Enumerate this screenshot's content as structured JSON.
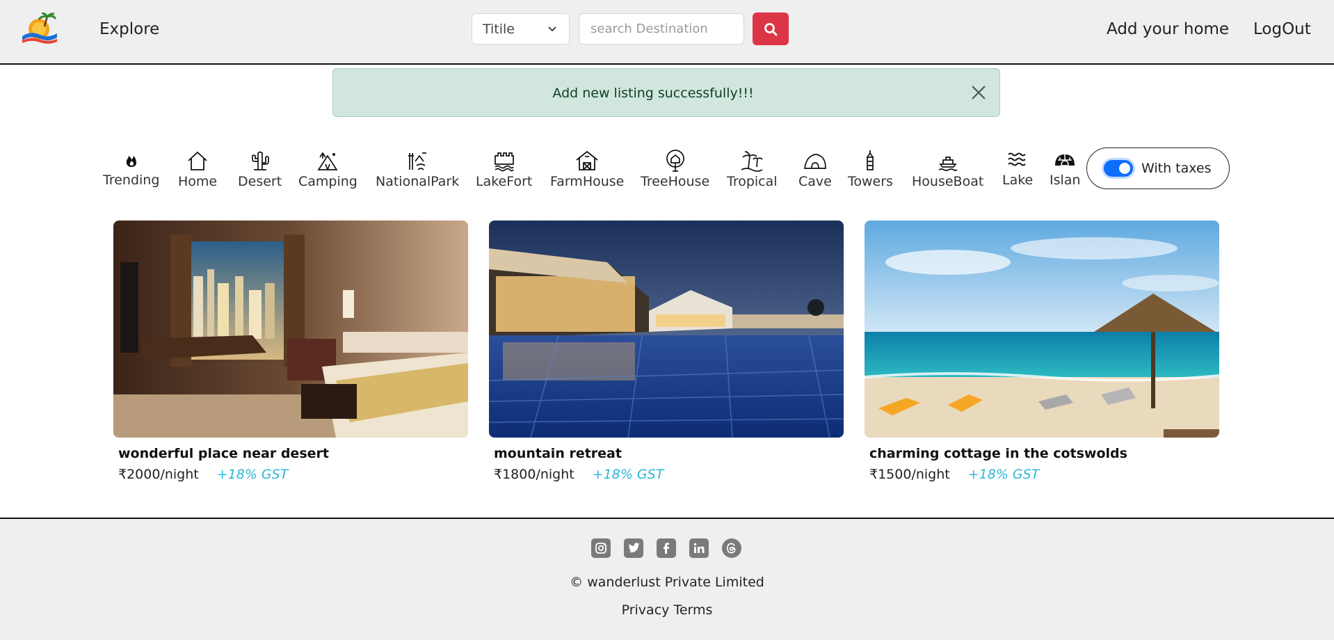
{
  "nav": {
    "explore": "Explore",
    "search_select": "Titile",
    "search_placeholder": "search Destination",
    "add_home": "Add your home",
    "logout": "LogOut"
  },
  "alert": {
    "message": "Add new listing successfully!!!"
  },
  "filters": [
    {
      "label": "Trending",
      "icon": "fire-icon"
    },
    {
      "label": "Home",
      "icon": "house-icon"
    },
    {
      "label": "Desert",
      "icon": "cactus-icon"
    },
    {
      "label": "Camping",
      "icon": "tent-icon"
    },
    {
      "label": "NationalPark",
      "icon": "park-icon"
    },
    {
      "label": "LakeFort",
      "icon": "fort-icon"
    },
    {
      "label": "FarmHouse",
      "icon": "farmhouse-icon"
    },
    {
      "label": "TreeHouse",
      "icon": "treehouse-icon"
    },
    {
      "label": "Tropical",
      "icon": "palm-icon"
    },
    {
      "label": "Cave",
      "icon": "cave-icon"
    },
    {
      "label": "Towers",
      "icon": "tower-icon"
    },
    {
      "label": "HouseBoat",
      "icon": "ship-icon"
    },
    {
      "label": "Lake",
      "icon": "water-icon"
    },
    {
      "label": "Islan",
      "icon": "igloo-icon"
    }
  ],
  "tax_toggle": {
    "label": "With taxes",
    "on": true
  },
  "listings": [
    {
      "title": "wonderful place near desert",
      "price": "₹2000/night",
      "gst": "+18% GST",
      "image": "hotel-room-image"
    },
    {
      "title": "mountain retreat",
      "price": "₹1800/night",
      "gst": "+18% GST",
      "image": "pool-resort-image"
    },
    {
      "title": "charming cottage in the cotswolds",
      "price": "₹1500/night",
      "gst": "+18% GST",
      "image": "beach-umbrella-image"
    }
  ],
  "footer": {
    "social": [
      "instagram-icon",
      "twitter-icon",
      "facebook-icon",
      "linkedin-icon",
      "threads-icon"
    ],
    "copyright": "© wanderlust Private Limited",
    "privacy": "Privacy",
    "terms": "Terms"
  },
  "colors": {
    "accent": "#dc3545",
    "alert_bg": "#d1e7dd",
    "toggle": "#0d6efd",
    "gst": "#2bb8d8",
    "nav_bg": "#f0eff0"
  }
}
